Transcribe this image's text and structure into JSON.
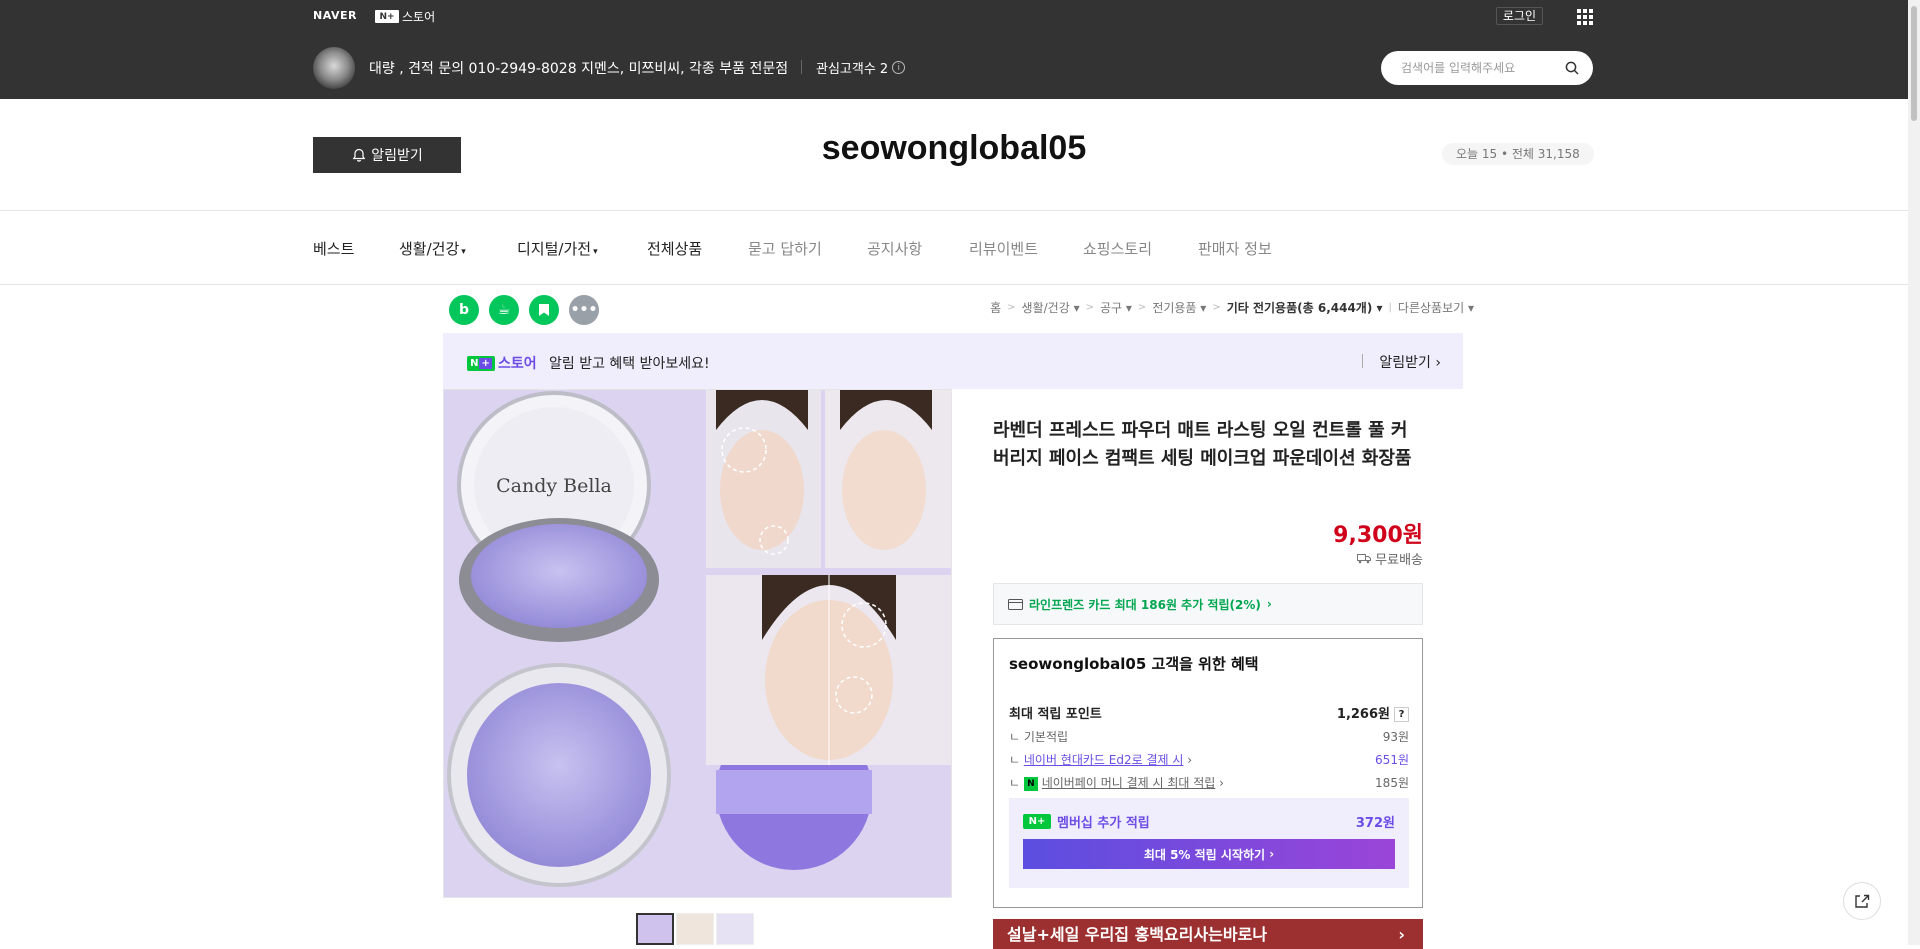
{
  "header": {
    "naver_logo": "NAVER",
    "store_logo_badge": "N+",
    "store_logo_text": "스토어",
    "login_label": "로그인",
    "store_description": "대량 , 견적 문의 010-2949-8028 지멘스, 미쯔비씨, 각종 부품 전문점",
    "favorite_label": "관심고객수 2",
    "search_placeholder": "검색어를 입력해주세요"
  },
  "store": {
    "notify_label": "알림받기",
    "title": "seowonglobal05",
    "visits": "오늘 15 • 전체 31,158"
  },
  "nav": {
    "items": [
      "베스트",
      "생활/건강",
      "디지털/가전",
      "전체상품",
      "묻고 답하기",
      "공지사항",
      "리뷰이벤트",
      "쇼핑스토리",
      "판매자 정보"
    ]
  },
  "breadcrumb": {
    "home": "홈",
    "c1": "생활/건강",
    "c2": "공구",
    "c3": "전기용품",
    "c4": "기타 전기용품(총 6,444개)",
    "other": "다른상품보기"
  },
  "promo": {
    "logo_text": "스토어",
    "message": "알림 받고 혜택 받아보세요!",
    "action": "알림받기"
  },
  "product": {
    "image_brand": "Candy Bella",
    "title": "라벤더 프레스드 파우더 매트 라스팅 오일 컨트롤 풀 커버리지 페이스 컴팩트 세팅 메이크업 파운데이션 화장품",
    "price": "9,300원",
    "delivery": "무료배송",
    "card_benefit": "라인프렌즈 카드 최대 186원 추가 적립(2%)"
  },
  "benefit": {
    "heading_store": "seowonglobal05",
    "heading_rest": " 고객을 위한 혜택",
    "max_points_label": "최대 적립 포인트",
    "max_points_value": "1,266원",
    "basic_label": "기본적립",
    "basic_value": "93원",
    "card_label": "네이버 현대카드 Ed2로 결제 시",
    "card_value": "651원",
    "pay_label": "네이버페이 머니 결제 시 최대 적립",
    "pay_value": "185원",
    "member_label": "멤버십 추가 적립",
    "member_value": "372원",
    "member_cta": "최대 5% 적립 시작하기"
  },
  "ad": {
    "text": "설날+세일 우리집 홍백요리사는바로나"
  },
  "colors": {
    "header_bg": "#333333",
    "price_red": "#d0021b",
    "naver_green": "#00c73c",
    "purple": "#6b4de6"
  }
}
